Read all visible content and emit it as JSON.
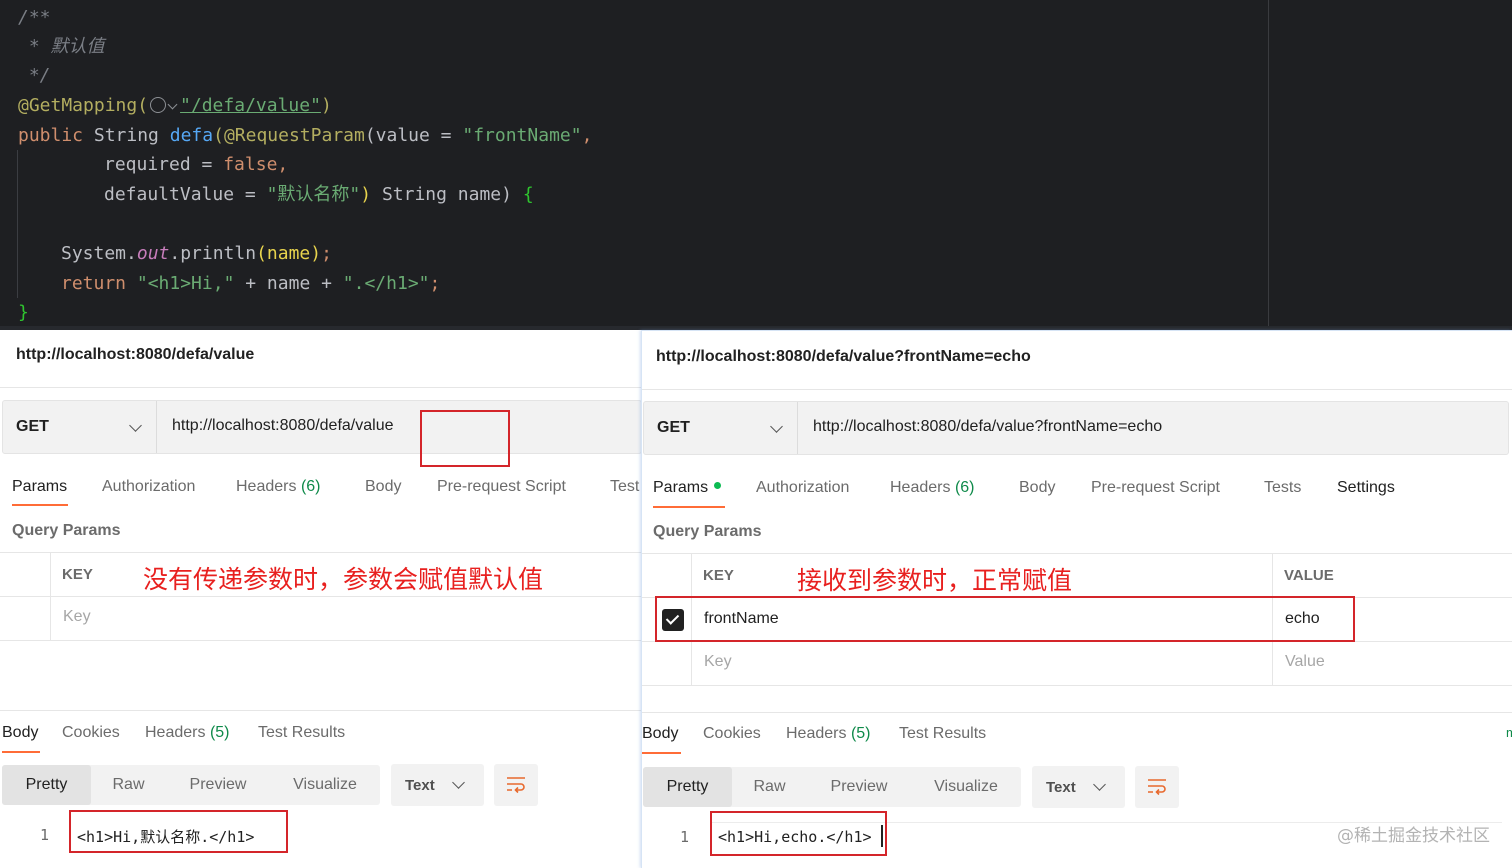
{
  "editor": {
    "lines": [
      "/**",
      " * 默认值",
      " */",
      "@GetMapping(",
      "\"/defa/value\"",
      ")",
      "public",
      "String",
      "defa",
      "(@RequestParam",
      "(value = ",
      "\"frontName\"",
      ",",
      "required = ",
      "false",
      ",",
      "defaultValue = ",
      "\"默认名称\"",
      ")",
      "String name) ",
      "{",
      "System.",
      "out",
      ".println",
      "(name)",
      ";",
      "return",
      "\"<h1>Hi,\"",
      " + name + ",
      "\".</h1>\"",
      ";",
      "}"
    ]
  },
  "left": {
    "title": "http://localhost:8080/defa/value",
    "method": "GET",
    "url": "http://localhost:8080/defa/value",
    "tabs": {
      "params": "Params",
      "authorization": "Authorization",
      "headers": "Headers",
      "headers_count": "(6)",
      "body": "Body",
      "prerequest": "Pre-request Script",
      "tests": "Test"
    },
    "query_params_label": "Query Params",
    "key_header": "KEY",
    "key_placeholder": "Key",
    "annotation": "没有传递参数时，参数会赋值默认值",
    "resp_tabs": {
      "body": "Body",
      "cookies": "Cookies",
      "headers": "Headers",
      "headers_count": "(5)",
      "test_results": "Test Results"
    },
    "views": [
      "Pretty",
      "Raw",
      "Preview",
      "Visualize"
    ],
    "format": "Text",
    "line_number": "1",
    "response": "<h1>Hi,默认名称.</h1>"
  },
  "right": {
    "title": "http://localhost:8080/defa/value?frontName=echo",
    "method": "GET",
    "url": "http://localhost:8080/defa/value?frontName=echo",
    "tabs": {
      "params": "Params",
      "authorization": "Authorization",
      "headers": "Headers",
      "headers_count": "(6)",
      "body": "Body",
      "prerequest": "Pre-request Script",
      "tests": "Tests",
      "settings": "Settings"
    },
    "query_params_label": "Query Params",
    "key_header": "KEY",
    "value_header": "VALUE",
    "param_key": "frontName",
    "param_value": "echo",
    "key_placeholder": "Key",
    "value_placeholder": "Value",
    "annotation": "接收到参数时，正常赋值",
    "resp_tabs": {
      "body": "Body",
      "cookies": "Cookies",
      "headers": "Headers",
      "headers_count": "(5)",
      "test_results": "Test Results"
    },
    "views": [
      "Pretty",
      "Raw",
      "Preview",
      "Visualize"
    ],
    "format": "Text",
    "line_number": "1",
    "response": "<h1>Hi,echo.</h1>",
    "edge_char": "m"
  },
  "watermark": "@稀土掘金技术社区",
  "colors": {
    "editor_bg": "#1e1f22",
    "accent_tab": "#ff6c37",
    "annotation_red": "#e8201f",
    "count_green": "#0f8a4a"
  }
}
